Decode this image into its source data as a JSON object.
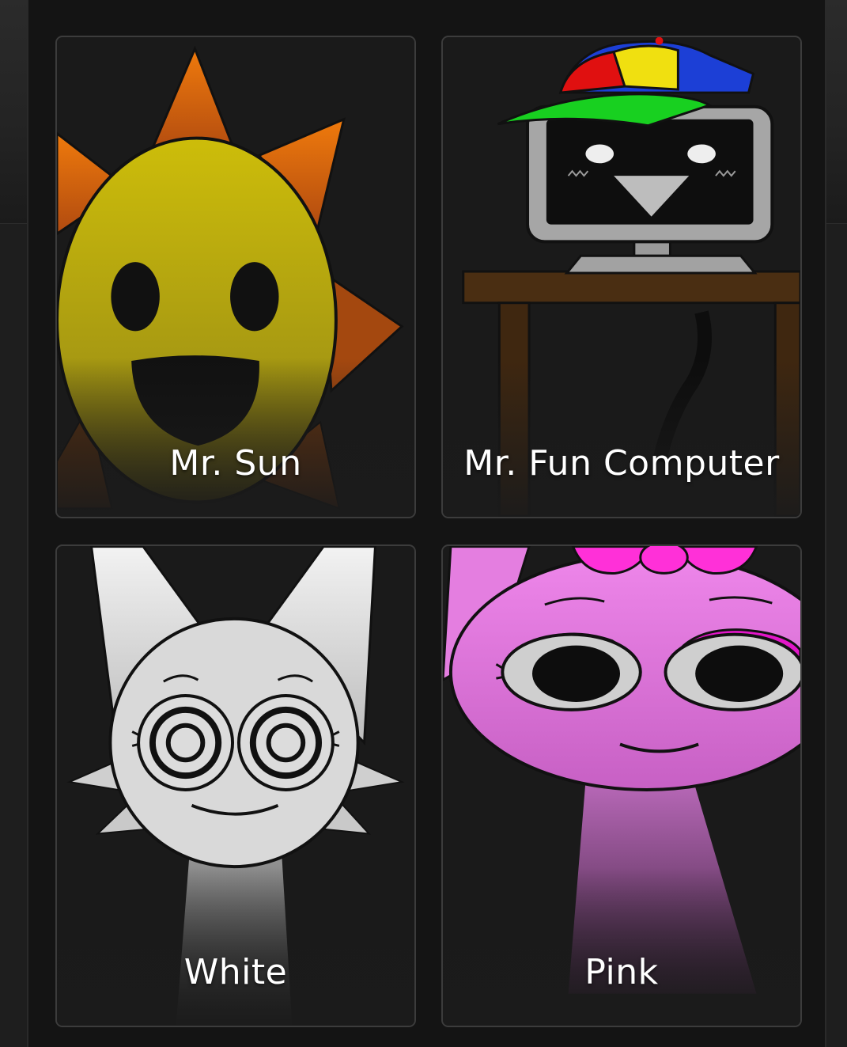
{
  "theme": {
    "background": "#141414",
    "card_border": "#3c3c3c",
    "label_color": "#ffffff"
  },
  "characters": [
    {
      "name": "Mr. Sun",
      "icon": "sun-character-icon",
      "color": "#c9b700"
    },
    {
      "name": "Mr. Fun Computer",
      "icon": "computer-character-icon",
      "color": "#a9a9a9"
    },
    {
      "name": "White",
      "icon": "white-character-icon",
      "color": "#e6e6e6"
    },
    {
      "name": "Pink",
      "icon": "pink-character-icon",
      "color": "#e070d8"
    }
  ]
}
